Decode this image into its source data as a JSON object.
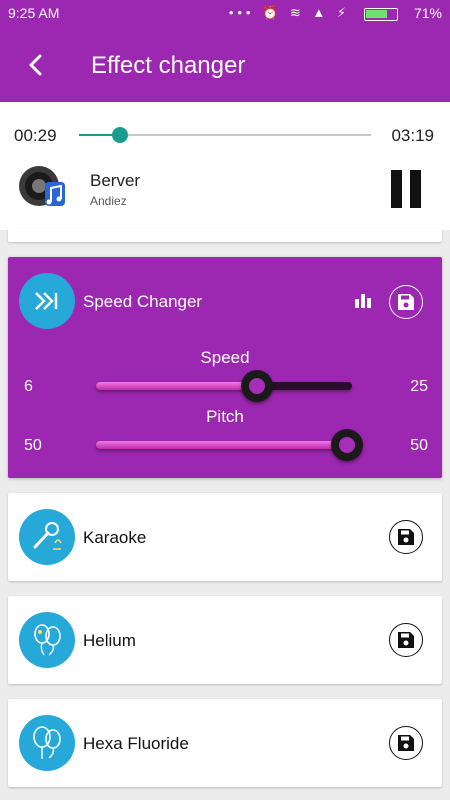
{
  "status_bar": {
    "time": "9:25 AM",
    "icons": "••• ⏰ ≋ ▲ ⚡",
    "battery_percent": "71%",
    "battery_level": 0.71
  },
  "app_bar": {
    "title": "Effect changer"
  },
  "player": {
    "current_time": "00:29",
    "total_time": "03:19",
    "progress": 0.14,
    "song_title": "Berver",
    "artist": "Andiez"
  },
  "speed_changer": {
    "name": "Speed Changer",
    "speed": {
      "label": "Speed",
      "min": "6",
      "max": "25",
      "level": 0.63
    },
    "pitch": {
      "label": "Pitch",
      "min": "50",
      "max": "50",
      "level": 0.98
    }
  },
  "effects": [
    {
      "name": "Karaoke",
      "icon": "microphone-icon"
    },
    {
      "name": "Helium",
      "icon": "balloons-icon"
    },
    {
      "name": "Hexa Fluoride",
      "icon": "balloons-sf-icon"
    }
  ],
  "colors": {
    "primary": "#9c27b0",
    "accent": "#1a9c8c",
    "icon_bg": "#26a9d8"
  }
}
